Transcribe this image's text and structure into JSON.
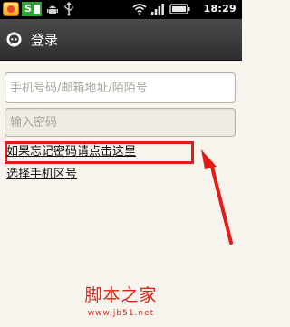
{
  "status_bar": {
    "carrier_badge": "S",
    "time": "18:29",
    "icons": [
      "app-notification-icon",
      "sms-icon",
      "android-debug-icon",
      "usb-icon",
      "wifi-icon",
      "signal-icon",
      "battery-icon"
    ]
  },
  "title_bar": {
    "title": "登录",
    "logo_icon": "momo-logo-icon"
  },
  "form": {
    "account_placeholder": "手机号码/邮箱地址/陌陌号",
    "password_placeholder": "输入密码",
    "forgot_password_link": "如果忘记密码请点击这里",
    "choose_region_link": "选择手机区号"
  },
  "annotation": {
    "highlight_color": "#e51b17"
  },
  "watermark": {
    "logo_text": "脚本之家",
    "url": "www.jb51.net"
  },
  "colors": {
    "background": "#f7f4ed",
    "title_bar": "#3a3a3a",
    "accent_red": "#e51b17"
  }
}
